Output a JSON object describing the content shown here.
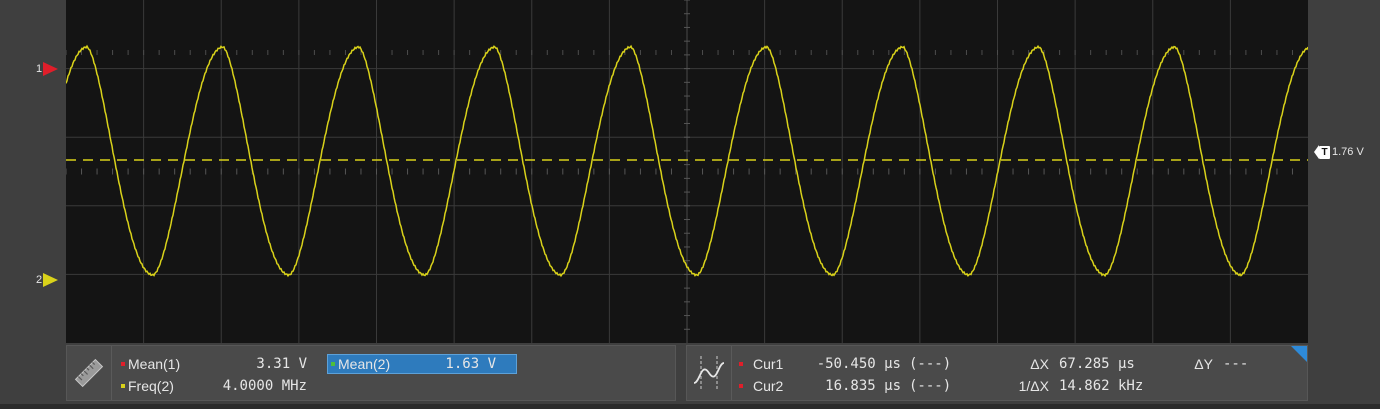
{
  "markers": {
    "ch1_label": "1",
    "ch2_label": "2",
    "trigger_badge": "T",
    "trigger_level": "1.76 V"
  },
  "colors": {
    "background": "#3f3f3f",
    "screen": "#141414",
    "grid": "#3a3a3a",
    "trace_ch2": "#d9d21a",
    "ch1_marker": "#e01e2a",
    "highlight": "#2e7bbd"
  },
  "waveform": {
    "channel": "2",
    "cycles": 9,
    "trigger_line": "dashed"
  },
  "measurements": {
    "icon": "ruler-icon",
    "mean1": {
      "label": "Mean(1)",
      "value": "3.31 V"
    },
    "freq2": {
      "label": "Freq(2)",
      "value": "4.0000 MHz"
    },
    "mean2": {
      "label": "Mean(2)",
      "value": "1.63 V"
    }
  },
  "cursors": {
    "icon": "cursor-wave-icon",
    "cur1": {
      "label": "Cur1",
      "value": "-50.450 µs",
      "status": "(---)"
    },
    "cur2": {
      "label": "Cur2",
      "value": "16.835 µs",
      "status": "(---)"
    },
    "dx": {
      "label": "ΔX",
      "value": "67.285 µs"
    },
    "invdx": {
      "label": "1/ΔX",
      "value": "14.862 kHz"
    },
    "dy": {
      "label": "ΔY",
      "value": "---"
    }
  }
}
